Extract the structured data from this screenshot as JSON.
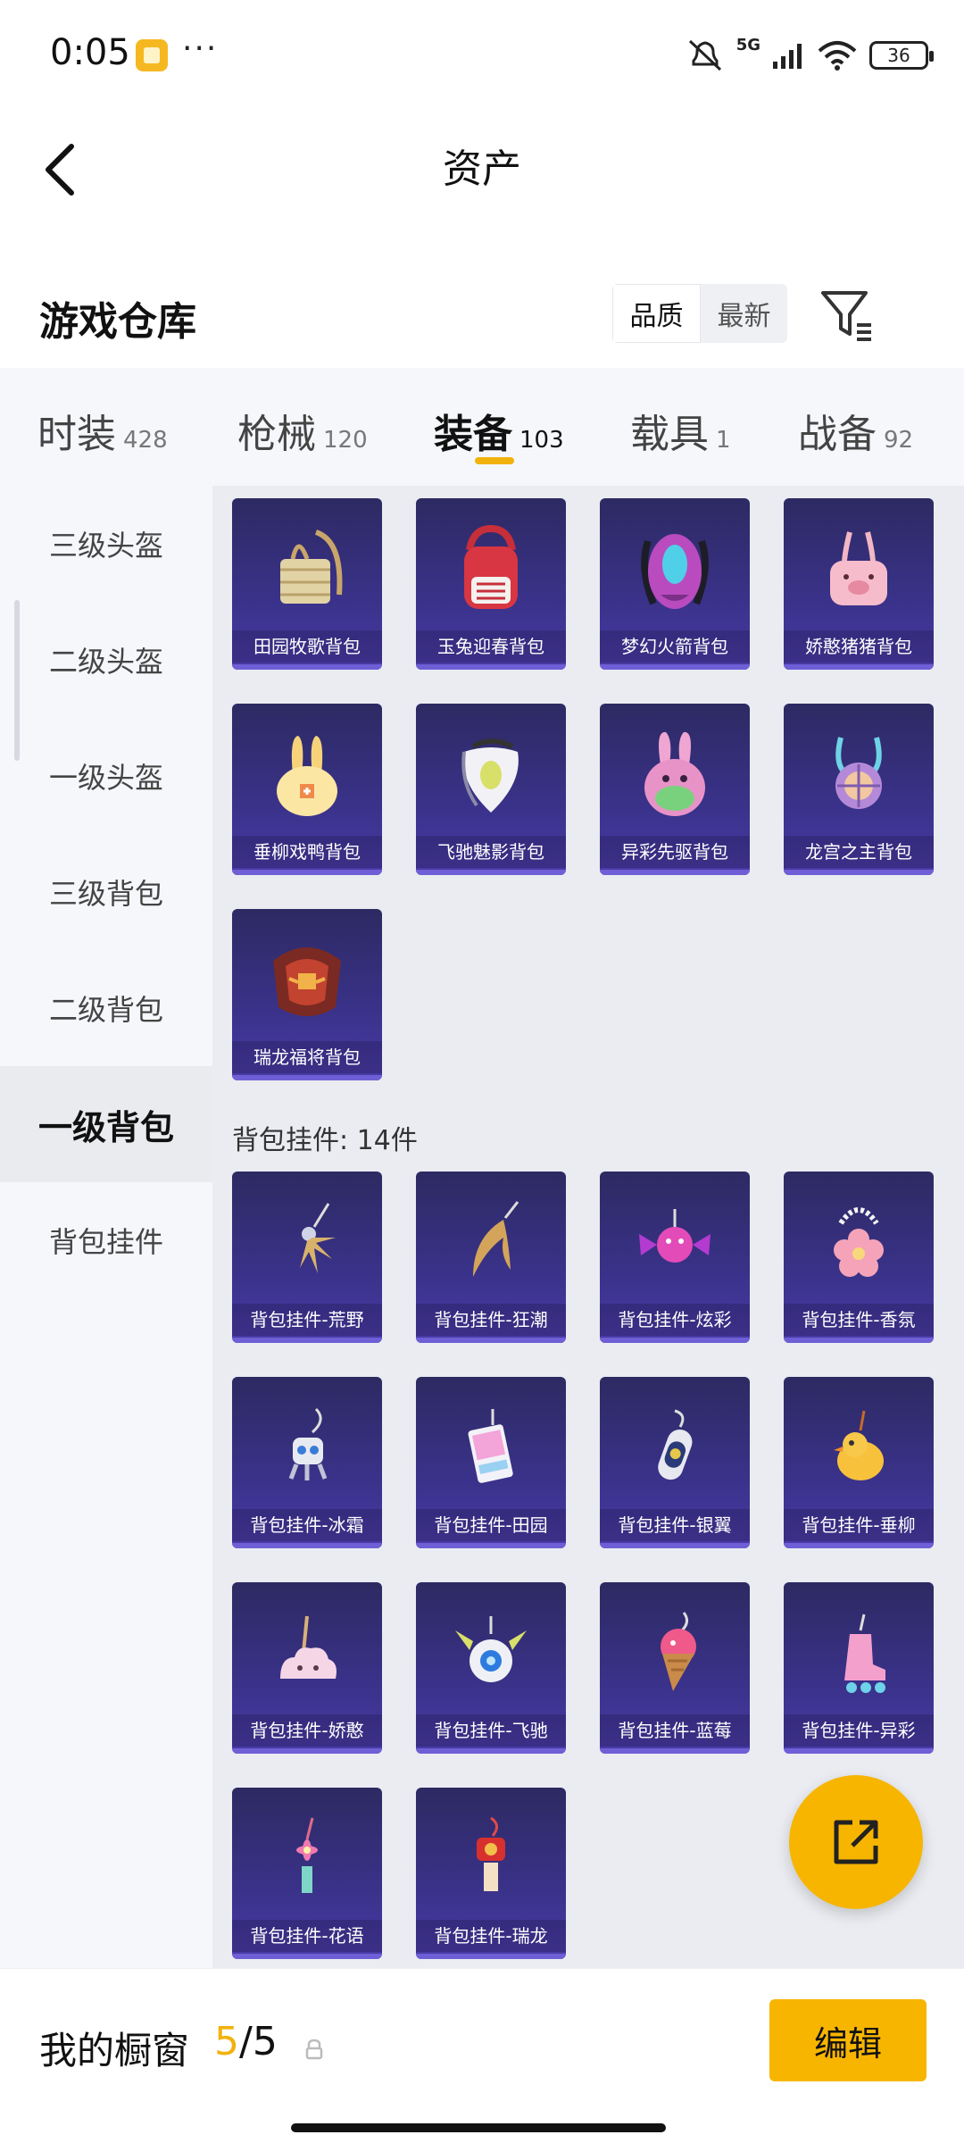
{
  "status_bar": {
    "time": "0:05",
    "network": "5G",
    "battery": "36"
  },
  "header": {
    "title": "资产"
  },
  "warehouse": {
    "title": "游戏仓库",
    "sort_options": [
      "品质",
      "最新"
    ],
    "sort_selected": "品质"
  },
  "tabs": [
    {
      "label": "时装",
      "count": "428"
    },
    {
      "label": "枪械",
      "count": "120"
    },
    {
      "label": "装备",
      "count": "103",
      "active": true
    },
    {
      "label": "载具",
      "count": "1"
    },
    {
      "label": "战备",
      "count": "92"
    }
  ],
  "sidebar": [
    {
      "label": "三级头盔"
    },
    {
      "label": "二级头盔"
    },
    {
      "label": "一级头盔"
    },
    {
      "label": "三级背包"
    },
    {
      "label": "二级背包"
    },
    {
      "label": "一级背包",
      "active": true
    },
    {
      "label": "背包挂件"
    }
  ],
  "backpacks": [
    {
      "name": "田园牧歌背包",
      "icon": "basket-backpack-icon"
    },
    {
      "name": "玉兔迎春背包",
      "icon": "red-backpack-icon"
    },
    {
      "name": "梦幻火箭背包",
      "icon": "rocket-backpack-icon"
    },
    {
      "name": "娇憨猪猪背包",
      "icon": "pig-backpack-icon"
    },
    {
      "name": "垂柳戏鸭背包",
      "icon": "duck-backpack-icon"
    },
    {
      "name": "飞驰魅影背包",
      "icon": "white-backpack-icon"
    },
    {
      "name": "异彩先驱背包",
      "icon": "bunny-backpack-icon"
    },
    {
      "name": "龙宫之主背包",
      "icon": "shell-backpack-icon"
    },
    {
      "name": "瑞龙福将背包",
      "icon": "dragon-backpack-icon"
    }
  ],
  "pendant_section": {
    "title": "背包挂件: 14件"
  },
  "pendants": [
    {
      "name": "背包挂件-荒野",
      "icon": "sun-charm-icon"
    },
    {
      "name": "背包挂件-狂潮",
      "icon": "blade-charm-icon"
    },
    {
      "name": "背包挂件-炫彩",
      "icon": "candy-charm-icon"
    },
    {
      "name": "背包挂件-香氛",
      "icon": "flower-charm-icon"
    },
    {
      "name": "背包挂件-冰霜",
      "icon": "robot-charm-icon"
    },
    {
      "name": "背包挂件-田园",
      "icon": "card-charm-icon"
    },
    {
      "name": "背包挂件-银翼",
      "icon": "capsule-charm-icon"
    },
    {
      "name": "背包挂件-垂柳",
      "icon": "duck-charm-icon"
    },
    {
      "name": "背包挂件-娇憨",
      "icon": "cloud-charm-icon"
    },
    {
      "name": "背包挂件-飞驰",
      "icon": "orb-charm-icon"
    },
    {
      "name": "背包挂件-蓝莓",
      "icon": "icecream-charm-icon"
    },
    {
      "name": "背包挂件-异彩",
      "icon": "skate-charm-icon"
    },
    {
      "name": "背包挂件-花语",
      "icon": "tassel-charm-icon"
    },
    {
      "name": "背包挂件-瑞龙",
      "icon": "lucky-charm-icon"
    }
  ],
  "bottom_bar": {
    "label": "我的橱窗",
    "count_current": "5",
    "count_sep": "/",
    "count_total": "5",
    "edit_label": "编辑"
  },
  "colors": {
    "accent": "#f7b500",
    "card_bg": "#3a328a",
    "panel_bg": "#f5f7fb"
  }
}
